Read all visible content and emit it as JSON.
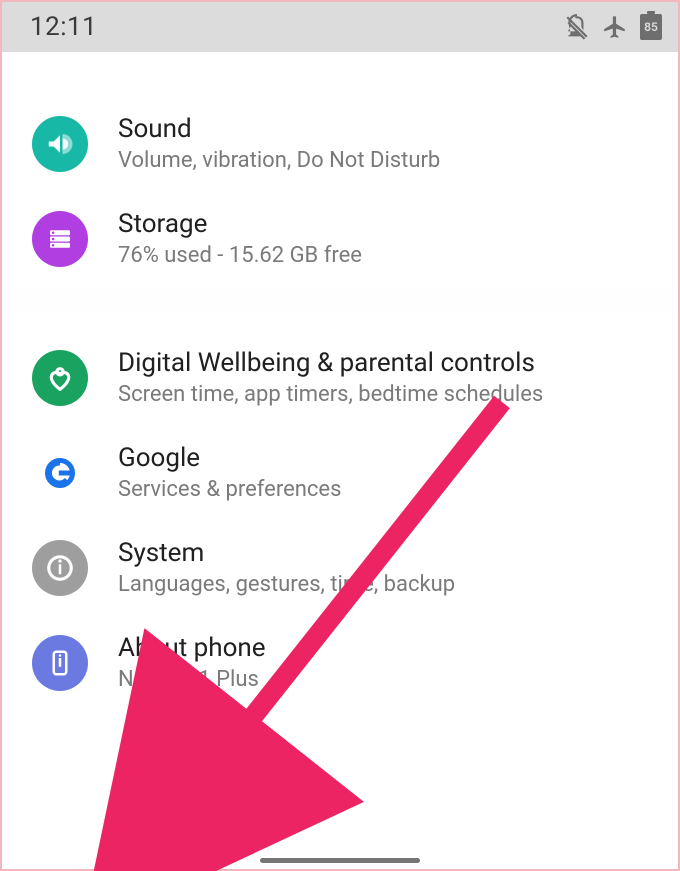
{
  "statusbar": {
    "time": "12:11",
    "battery": "85"
  },
  "items": [
    {
      "title": "Sound",
      "subtitle": "Volume, vibration, Do Not Disturb"
    },
    {
      "title": "Storage",
      "subtitle": "76% used - 15.62 GB free"
    },
    {
      "title": "Digital Wellbeing & parental controls",
      "subtitle": "Screen time, app timers, bedtime schedules"
    },
    {
      "title": "Google",
      "subtitle": "Services & preferences"
    },
    {
      "title": "System",
      "subtitle": "Languages, gestures, time, backup"
    },
    {
      "title": "About phone",
      "subtitle": "Nokia 6.1 Plus"
    }
  ]
}
